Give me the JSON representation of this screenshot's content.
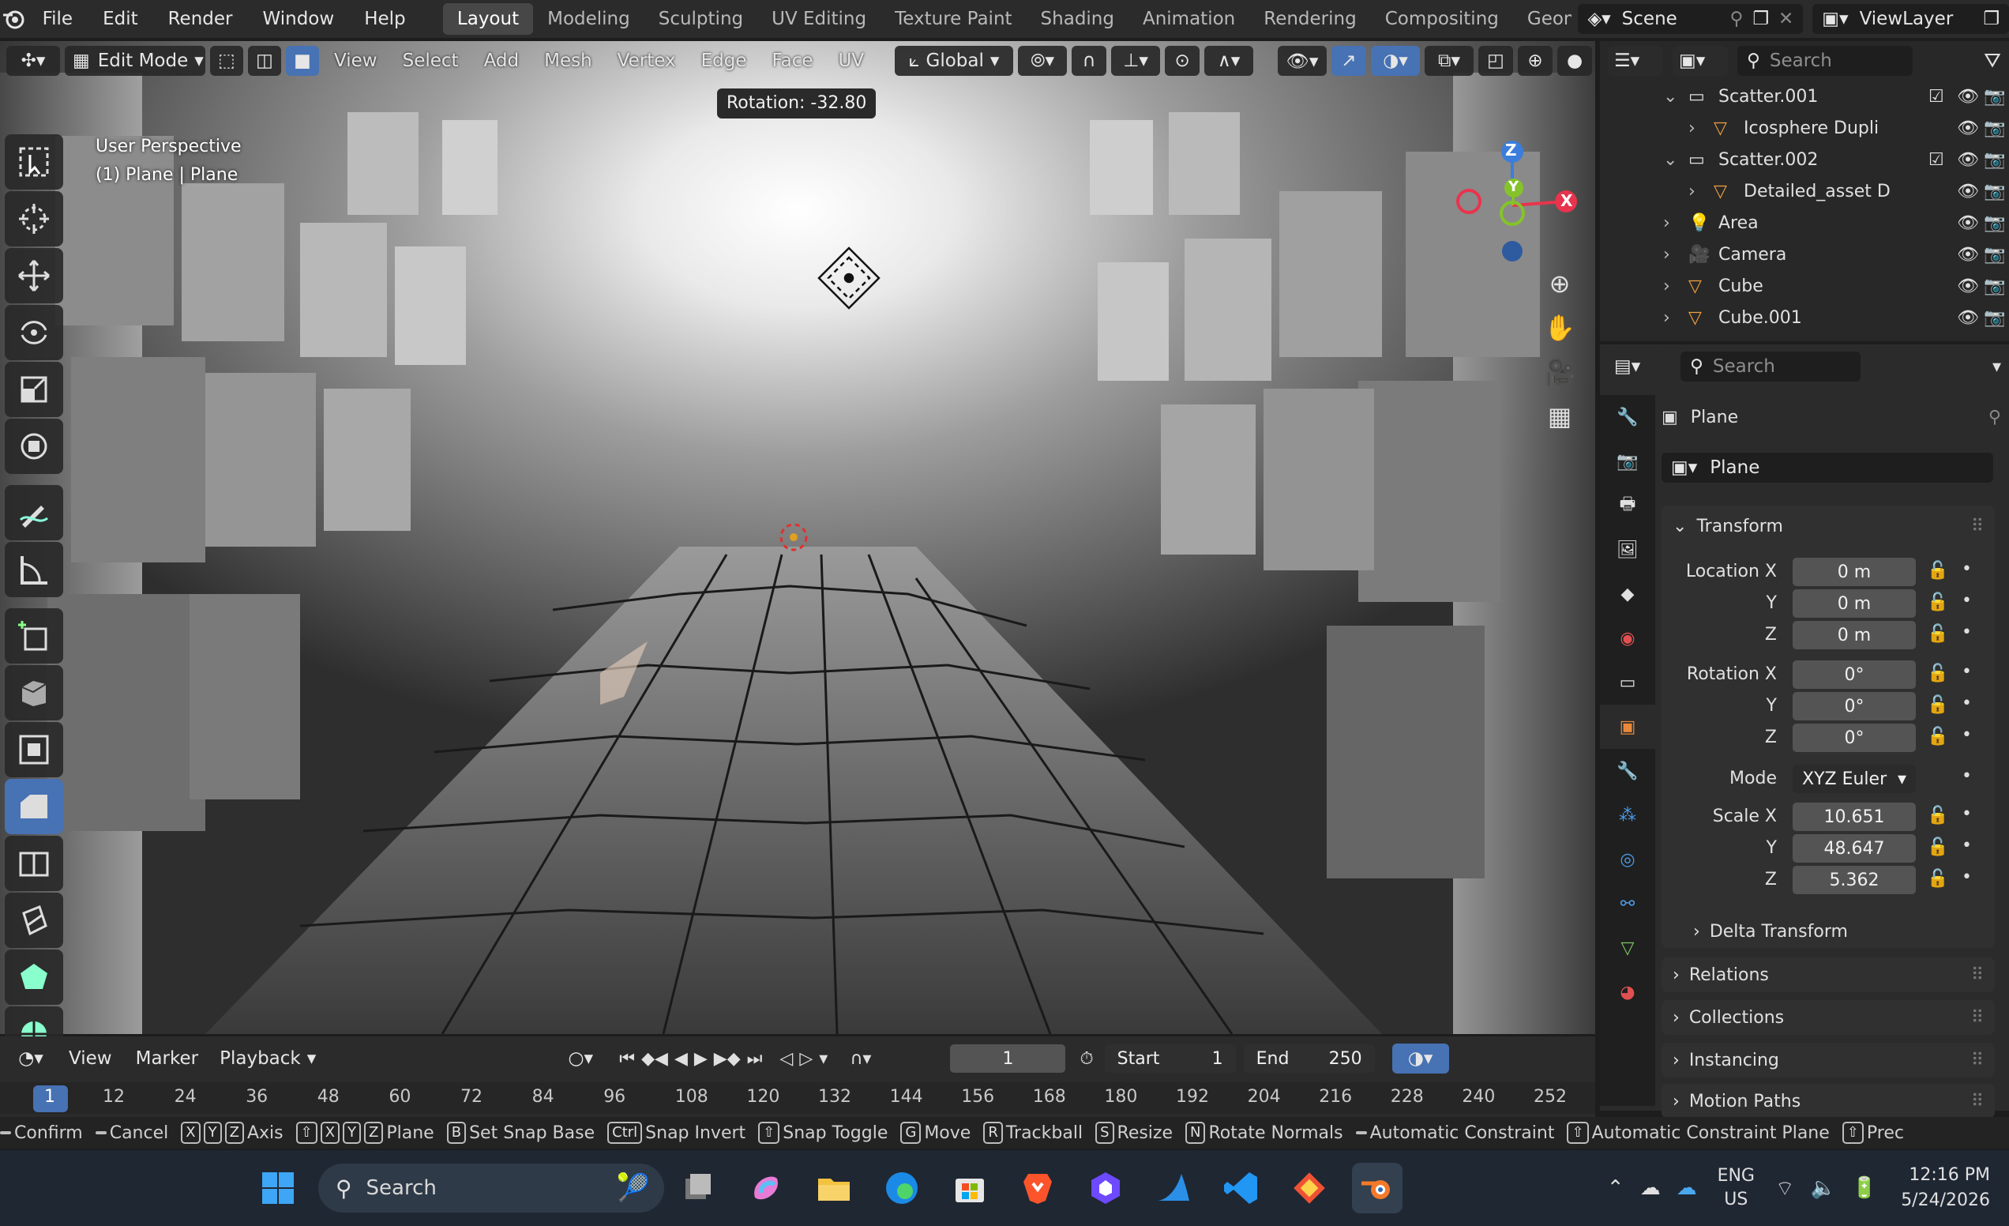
{
  "topbar": {
    "menus": [
      "File",
      "Edit",
      "Render",
      "Window",
      "Help"
    ],
    "workspaces": [
      "Layout",
      "Modeling",
      "Sculpting",
      "UV Editing",
      "Texture Paint",
      "Shading",
      "Animation",
      "Rendering",
      "Compositing",
      "Geome"
    ],
    "active_workspace": "Layout",
    "scene": "Scene",
    "view_layer": "ViewLayer"
  },
  "viewport": {
    "mode": "Edit Mode",
    "menus": [
      "View",
      "Select",
      "Add",
      "Mesh",
      "Vertex",
      "Edge",
      "Face",
      "UV"
    ],
    "transform_orientation": "Global",
    "overlay_text_1": "User Perspective",
    "overlay_text_2": "(1) Plane | Plane",
    "rotation_readout": "Rotation: -32.80",
    "gizmo_x": "X",
    "gizmo_y": "Y",
    "gizmo_z": "Z",
    "colors": {
      "x_axis": "#e8344d",
      "y_axis": "#84c32a",
      "z_axis": "#3b7ddb",
      "active_tool": "#4772b3"
    }
  },
  "outliner": {
    "search_placeholder": "Search",
    "rows": [
      {
        "name": "Scatter.001",
        "kind": "collection",
        "indent": 1
      },
      {
        "name": "Icosphere Dupli",
        "kind": "mesh",
        "indent": 2
      },
      {
        "name": "Scatter.002",
        "kind": "collection",
        "indent": 1
      },
      {
        "name": "Detailed_asset D",
        "kind": "mesh",
        "indent": 2
      },
      {
        "name": "Area",
        "kind": "light",
        "indent": 1
      },
      {
        "name": "Camera",
        "kind": "camera",
        "indent": 1
      },
      {
        "name": "Cube",
        "kind": "mesh",
        "indent": 1
      },
      {
        "name": "Cube.001",
        "kind": "mesh",
        "indent": 1
      }
    ]
  },
  "properties": {
    "search_placeholder": "Search",
    "object_name": "Plane",
    "datablock_name": "Plane",
    "transform_title": "Transform",
    "location": {
      "label_x": "Location X",
      "label_y": "Y",
      "label_z": "Z",
      "x": "0 m",
      "y": "0 m",
      "z": "0 m"
    },
    "rotation": {
      "label_x": "Rotation X",
      "label_y": "Y",
      "label_z": "Z",
      "x": "0°",
      "y": "0°",
      "z": "0°"
    },
    "mode_label": "Mode",
    "mode_value": "XYZ Euler",
    "scale": {
      "label_x": "Scale X",
      "label_y": "Y",
      "label_z": "Z",
      "x": "10.651",
      "y": "48.647",
      "z": "5.362"
    },
    "panels": [
      "Delta Transform",
      "Relations",
      "Collections",
      "Instancing",
      "Motion Paths"
    ]
  },
  "timeline": {
    "menus": [
      "View",
      "Marker",
      "Playback"
    ],
    "current_frame": "1",
    "start_label": "Start",
    "start": "1",
    "end_label": "End",
    "end": "250",
    "ruler": [
      "1",
      "12",
      "24",
      "36",
      "48",
      "60",
      "72",
      "84",
      "96",
      "108",
      "120",
      "132",
      "144",
      "156",
      "168",
      "180",
      "192",
      "204",
      "216",
      "228",
      "240",
      "252"
    ]
  },
  "statusbar": {
    "items": [
      {
        "keys": [],
        "label": "Confirm"
      },
      {
        "keys": [],
        "label": "Cancel"
      },
      {
        "keys": [
          "X",
          "Y",
          "Z"
        ],
        "label": "Axis"
      },
      {
        "keys": [
          "⇧",
          "X",
          "Y",
          "Z"
        ],
        "label": "Plane"
      },
      {
        "keys": [
          "B"
        ],
        "label": "Set Snap Base"
      },
      {
        "keys": [
          "Ctrl"
        ],
        "label": "Snap Invert"
      },
      {
        "keys": [
          "⇧"
        ],
        "label": "Snap Toggle"
      },
      {
        "keys": [
          "G"
        ],
        "label": "Move"
      },
      {
        "keys": [
          "R"
        ],
        "label": "Trackball"
      },
      {
        "keys": [
          "S"
        ],
        "label": "Resize"
      },
      {
        "keys": [
          "N"
        ],
        "label": "Rotate Normals"
      },
      {
        "keys": [],
        "label": "Automatic Constraint"
      },
      {
        "keys": [
          "⇧"
        ],
        "label": "Automatic Constraint Plane"
      },
      {
        "keys": [
          "⇧"
        ],
        "label": "Prec"
      }
    ]
  },
  "taskbar": {
    "search_placeholder": "Search",
    "language": "ENG",
    "region": "US",
    "time": "12:16 PM",
    "date": "5/24/2026"
  }
}
